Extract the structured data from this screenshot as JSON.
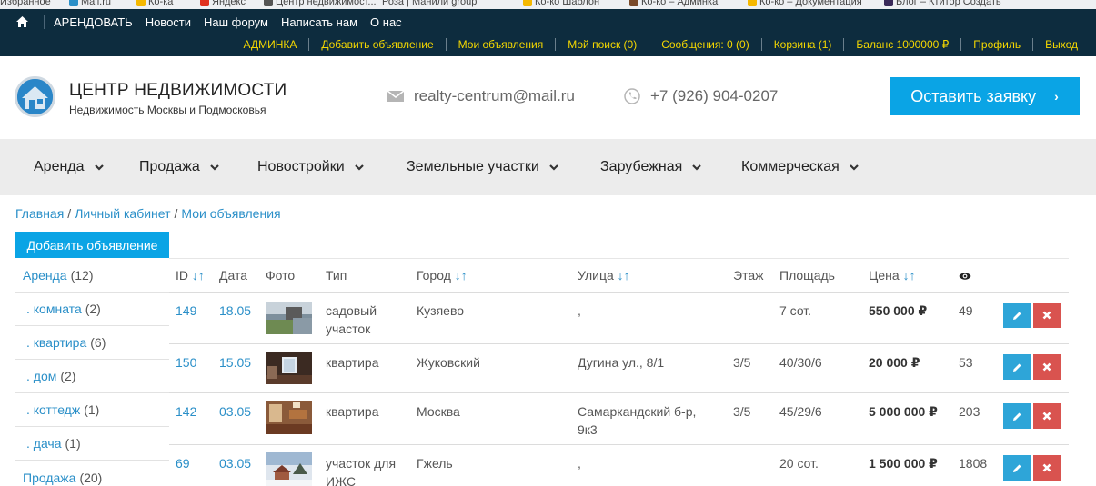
{
  "bookmarks": [
    "Избранное",
    "Mail.ru",
    "Ко-ка",
    "Яндекс",
    "Центр недвижимост...",
    "Роза | Манили group",
    "Ко-ко Шаблон",
    "Ко-ко – Админка",
    "Ко-ко – Документация",
    "Блог – Ктитор Создать"
  ],
  "topnav": {
    "items": [
      "АРЕНДОВАТЬ",
      "Новости",
      "Наш форум",
      "Написать нам",
      "О нас"
    ]
  },
  "usernav": {
    "items": [
      "АДМИНКА",
      "Добавить объявление",
      "Мои объявления",
      "Мой поиск (0)",
      "Сообщения: 0 (0)",
      "Корзина (1)",
      "Баланс 1000000 ₽",
      "Профиль",
      "Выход"
    ]
  },
  "header": {
    "title": "ЦЕНТР НЕДВИЖИМОСТИ",
    "subtitle": "Недвижимость Москвы и Подмосковья",
    "email": "realty-centrum@mail.ru",
    "phone": "+7 (926) 904-0207",
    "request_button": "Оставить заявку"
  },
  "mainnav": [
    "Аренда",
    "Продажа",
    "Новостройки",
    "Земельные участки",
    "Зарубежная",
    "Коммерческая"
  ],
  "breadcrumb": [
    "Главная",
    "Личный кабинет",
    "Мои объявления"
  ],
  "add_button": "Добавить объявление",
  "sidebar": [
    {
      "label": "Аренда",
      "count": "(12)",
      "level": "main"
    },
    {
      "label": ". комната",
      "count": "(2)",
      "level": "sub"
    },
    {
      "label": ". квартира",
      "count": "(6)",
      "level": "sub"
    },
    {
      "label": ". дом",
      "count": "(2)",
      "level": "sub"
    },
    {
      "label": ". коттедж",
      "count": "(1)",
      "level": "sub"
    },
    {
      "label": ". дача",
      "count": "(1)",
      "level": "sub"
    },
    {
      "label": "Продажа",
      "count": "(20)",
      "level": "main"
    }
  ],
  "table": {
    "headers": {
      "id": "ID",
      "date": "Дата",
      "photo": "Фото",
      "type": "Тип",
      "city": "Город",
      "street": "Улица",
      "floor": "Этаж",
      "area": "Площадь",
      "price": "Цена",
      "sort_arrow": "↓↑"
    },
    "rows": [
      {
        "id": "149",
        "date": "18.05",
        "type": "садовый участок",
        "city": "Кузяево",
        "street": ",",
        "floor": "",
        "area": "7 сот.",
        "price": "550 000 ₽",
        "views": "49",
        "photo": "field"
      },
      {
        "id": "150",
        "date": "15.05",
        "type": "квартира",
        "city": "Жуковский",
        "street": "Дугина ул., 8/1",
        "floor": "3/5",
        "area": "40/30/6",
        "price": "20 000 ₽",
        "views": "53",
        "photo": "room"
      },
      {
        "id": "142",
        "date": "03.05",
        "type": "квартира",
        "city": "Москва",
        "street": "Самаркандский б-р, 9к3",
        "floor": "3/5",
        "area": "45/29/6",
        "price": "5 000 000 ₽",
        "views": "203",
        "photo": "interior"
      },
      {
        "id": "69",
        "date": "03.05",
        "type": "участок для ИЖС",
        "city": "Гжель",
        "street": ",",
        "floor": "",
        "area": "20 сот.",
        "price": "1 500 000 ₽",
        "views": "1808",
        "photo": "winter"
      }
    ]
  },
  "colors": {
    "topbar": "#0d2c3e",
    "usernav_link": "#f5d800",
    "accent": "#0aa4e5",
    "link": "#2a8fc8",
    "edit_button": "#2ea5d8",
    "delete_button": "#d9534f",
    "mainnav_bg": "#ececec"
  },
  "icons": [
    "home-icon",
    "envelope-icon",
    "phone-icon",
    "chevron-right-icon",
    "chevron-down-icon",
    "eye-icon",
    "pencil-icon",
    "close-icon"
  ]
}
